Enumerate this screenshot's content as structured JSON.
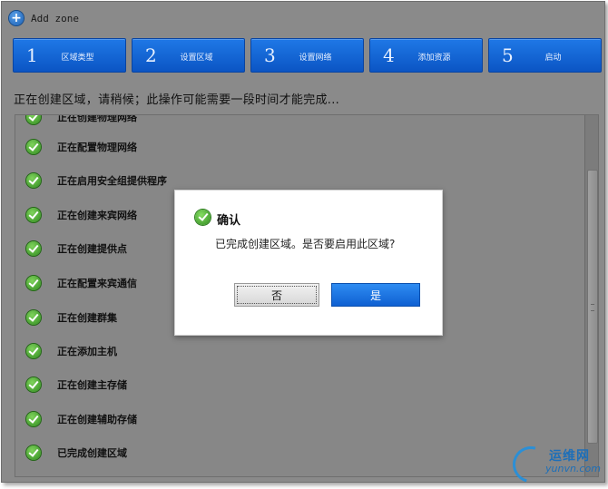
{
  "header": {
    "title": "Add zone"
  },
  "steps": [
    {
      "number": "1",
      "label": "区域类型"
    },
    {
      "number": "2",
      "label": "设置区域"
    },
    {
      "number": "3",
      "label": "设置网络"
    },
    {
      "number": "4",
      "label": "添加资源"
    },
    {
      "number": "5",
      "label": "启动"
    }
  ],
  "status_text": "正在创建区域，请稍候；此操作可能需要一段时间才能完成...",
  "progress_items": [
    {
      "label": "正在创建物理网络"
    },
    {
      "label": "正在配置物理网络"
    },
    {
      "label": "正在启用安全组提供程序"
    },
    {
      "label": "正在创建来宾网络"
    },
    {
      "label": "正在创建提供点"
    },
    {
      "label": "正在配置来宾通信"
    },
    {
      "label": "正在创建群集"
    },
    {
      "label": "正在添加主机"
    },
    {
      "label": "正在创建主存储"
    },
    {
      "label": "正在创建辅助存储"
    },
    {
      "label": "已完成创建区域"
    }
  ],
  "dialog": {
    "title": "确认",
    "message": "已完成创建区域。是否要启用此区域?",
    "no_label": "否",
    "yes_label": "是"
  },
  "watermark": {
    "cn": "运维网",
    "en": "yunvn.com"
  },
  "colors": {
    "accent": "#0b55c4",
    "success": "#2f8a1e",
    "overlay": "#8a8a8a"
  }
}
